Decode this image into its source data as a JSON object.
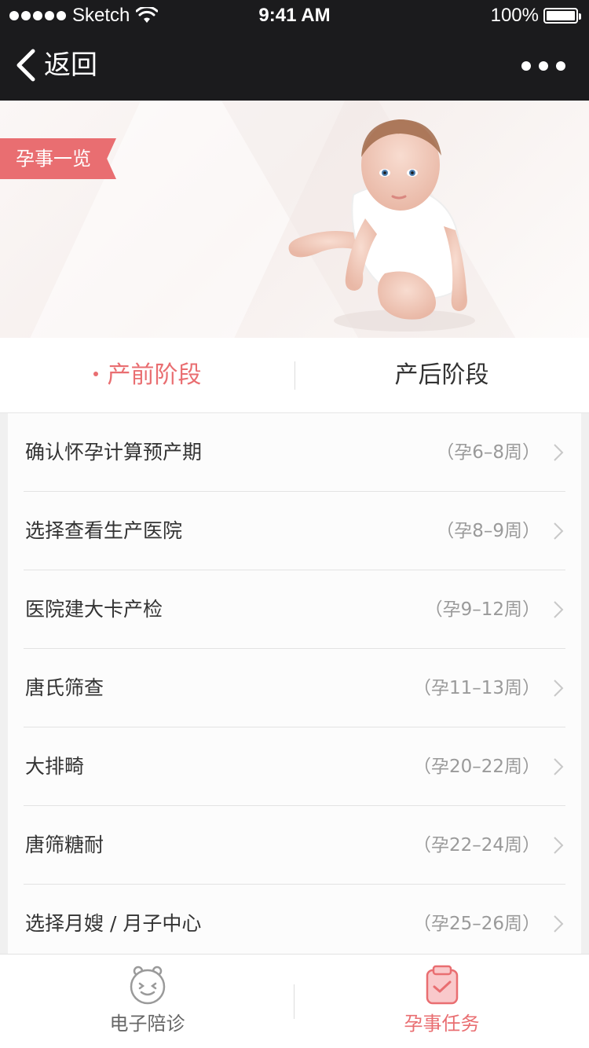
{
  "status_bar": {
    "carrier": "Sketch",
    "time": "9:41 AM",
    "battery": "100%",
    "battery_level": 1.0
  },
  "nav": {
    "back_label": "返回",
    "back_icon": "chevron-left-icon",
    "more_icon": "more-dots-icon"
  },
  "banner": {
    "ribbon_label": "孕事一览",
    "image": "baby-photo"
  },
  "tabs": [
    {
      "label": "产前阶段",
      "active": true
    },
    {
      "label": "产后阶段",
      "active": false
    }
  ],
  "list": {
    "items": [
      {
        "title": "确认怀孕计算预产期",
        "week": "（孕6–8周）"
      },
      {
        "title": "选择查看生产医院",
        "week": "（孕8–9周）"
      },
      {
        "title": "医院建大卡产检",
        "week": "（孕9–12周）"
      },
      {
        "title": "唐氏筛查",
        "week": "（孕11–13周）"
      },
      {
        "title": "大排畸",
        "week": "（孕20–22周）"
      },
      {
        "title": "唐筛糖耐",
        "week": "（孕22–24周）"
      },
      {
        "title": "选择月嫂 / 月子中心",
        "week": "（孕25–26周）"
      }
    ]
  },
  "tabbar": {
    "items": [
      {
        "label": "电子陪诊",
        "icon": "smiley-face-icon",
        "active": false
      },
      {
        "label": "孕事任务",
        "icon": "clipboard-check-icon",
        "active": true
      }
    ]
  },
  "colors": {
    "accent": "#e96e71",
    "nav_bg": "#1b1b1d"
  }
}
